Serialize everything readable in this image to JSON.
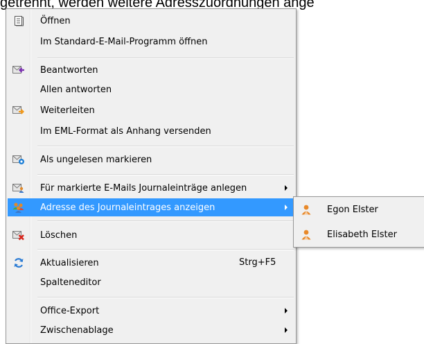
{
  "background_text": "getrennt, werden weitere Adresszuordnungen ange",
  "menu": {
    "items": [
      {
        "label": "Öffnen",
        "icon": "open-icon"
      },
      {
        "label": "Im Standard-E-Mail-Programm öffnen",
        "icon": ""
      },
      {
        "label": "Beantworten",
        "icon": "reply-icon"
      },
      {
        "label": "Allen antworten",
        "icon": ""
      },
      {
        "label": "Weiterleiten",
        "icon": "forward-icon"
      },
      {
        "label": "Im EML-Format als Anhang versenden",
        "icon": ""
      },
      {
        "label": "Als ungelesen markieren",
        "icon": "mark-unread-icon"
      },
      {
        "label": "Für markierte E-Mails Journaleinträge anlegen",
        "icon": "journal-add-icon"
      },
      {
        "label": "Adresse des Journaleintrages anzeigen",
        "icon": "contacts-icon"
      },
      {
        "label": "Löschen",
        "icon": "delete-icon"
      },
      {
        "label": "Aktualisieren",
        "icon": "refresh-icon",
        "shortcut": "Strg+F5"
      },
      {
        "label": "Spalteneditor",
        "icon": ""
      },
      {
        "label": "Office-Export",
        "icon": ""
      },
      {
        "label": "Zwischenablage",
        "icon": ""
      }
    ]
  },
  "submenu": {
    "items": [
      {
        "label": "Egon Elster",
        "icon": "person-icon"
      },
      {
        "label": "Elisabeth Elster",
        "icon": "person-icon"
      }
    ]
  },
  "colors": {
    "highlight": "#3399ff",
    "menu_bg": "#f0f0f0",
    "border": "#979797"
  }
}
